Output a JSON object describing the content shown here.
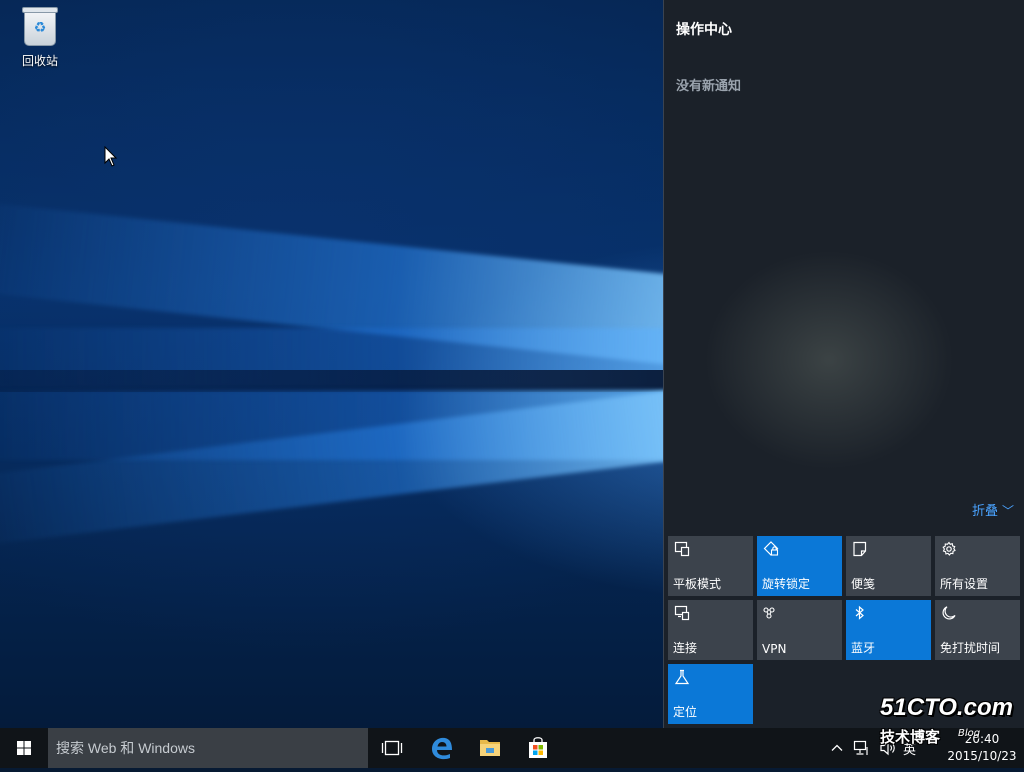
{
  "desktop": {
    "recycle_bin_label": "回收站"
  },
  "action_center": {
    "title": "操作中心",
    "empty_message": "没有新通知",
    "collapse_label": "折叠",
    "tiles": [
      {
        "label": "平板模式",
        "icon": "tablet-mode-icon",
        "active": false
      },
      {
        "label": "旋转锁定",
        "icon": "rotation-lock-icon",
        "active": true
      },
      {
        "label": "便笺",
        "icon": "note-icon",
        "active": false
      },
      {
        "label": "所有设置",
        "icon": "gear-icon",
        "active": false
      },
      {
        "label": "连接",
        "icon": "connect-icon",
        "active": false
      },
      {
        "label": "VPN",
        "icon": "vpn-icon",
        "active": false
      },
      {
        "label": "蓝牙",
        "icon": "bluetooth-icon",
        "active": true
      },
      {
        "label": "免打扰时间",
        "icon": "moon-icon",
        "active": false
      },
      {
        "label": "定位",
        "icon": "location-icon",
        "active": true
      }
    ]
  },
  "taskbar": {
    "search_placeholder": "搜索 Web 和 Windows",
    "pinned_apps": [
      "task-view-icon",
      "edge-icon",
      "file-explorer-icon",
      "store-icon"
    ],
    "ime": "英",
    "clock": {
      "time": "20:40",
      "date": "2015/10/23"
    }
  },
  "watermark": {
    "line1": "51CTO.com",
    "line2": "技术博客",
    "line3": "Blog"
  },
  "colors": {
    "accent": "#0b78d7",
    "tile_off": "#3c434c",
    "action_center_bg": "#1b2129",
    "taskbar_bg": "#101418",
    "collapse_link": "#4aa3ff"
  }
}
